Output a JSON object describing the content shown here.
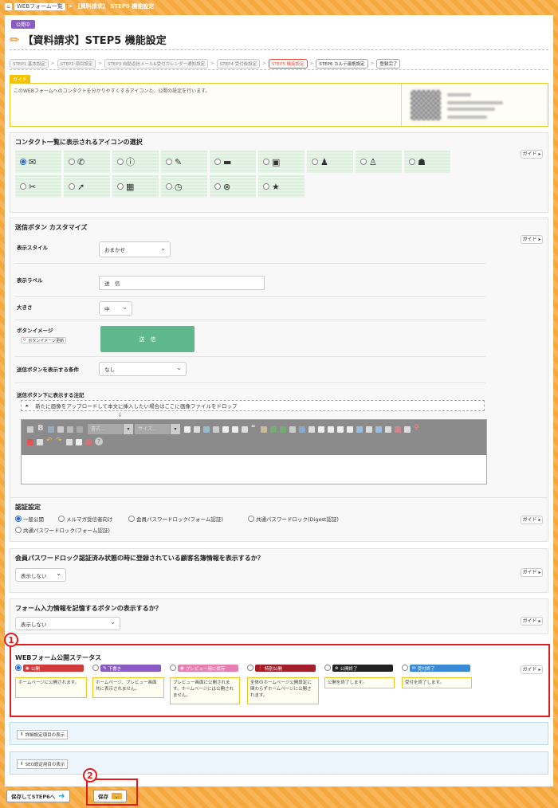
{
  "breadcrumb": {
    "home_icon": "home-icon",
    "item1": "WEBフォーム一覧",
    "item2": "【資料請求】 STEP5 機能設定"
  },
  "header": {
    "badge": "公開中",
    "title": "【資料請求】STEP5 機能設定",
    "title_icon": "pencil-icon"
  },
  "steps": [
    {
      "label": "STEP1 基本設定"
    },
    {
      "label": "STEP2 項目設定"
    },
    {
      "label": "STEP3 自動返信メール&受付カレンダー通知設定"
    },
    {
      "label": "STEP4 受付後設定"
    },
    {
      "label": "STEP5 機能設定"
    },
    {
      "label": "STEP6 カルテ連携設定"
    },
    {
      "label": "登録完了"
    }
  ],
  "guide": {
    "tag": "ガイド",
    "text": "このWEBフォームへのコンタクトを分かりやすくするアイコンと、公開の設定を行います。"
  },
  "guide_button": "ガイド",
  "icon_select": {
    "title": "コンタクト一覧に表示されるアイコンの選択",
    "icons": [
      "mail-icon",
      "phone-icon",
      "exclamation-icon",
      "pen-icon",
      "monitor-icon",
      "note-icon",
      "person-icon",
      "person-alt-icon",
      "people-icon",
      "ticket-icon",
      "arrow-icon",
      "calendar-icon",
      "clock-icon",
      "cancel-icon",
      "star-icon"
    ]
  },
  "send_button": {
    "title": "送信ボタン カスタマイズ",
    "style_label": "表示スタイル",
    "style_value": "おまかせ",
    "text_label": "表示ラベル",
    "text_value": "送　信",
    "size_label": "大きさ",
    "size_value": "中",
    "image_label": "ボタンイメージ",
    "image_update": "ボタンイメージ更新",
    "preview": "送　信",
    "condition_label": "送信ボタンを表示する条件",
    "condition_value": "なし",
    "note_label": "送信ボタン下に表示する注記",
    "drop_text": "新たに画像をアップロードして本文に挿入したい場合はここに画像ファイルをドロップ",
    "format_placeholder": "書式...",
    "size_placeholder": "サイズ..."
  },
  "auth": {
    "title": "認証設定",
    "options": [
      "一般公開",
      "メルマガ受信者向け",
      "会員パスワードロック(フォーム認証)",
      "共通パスワードロック(Digest認証)",
      "共通パスワードロック(フォーム認証)"
    ]
  },
  "member_info": {
    "title": "会員パスワードロック認証済み状態の時に登録されている顧客名簿情報を表示するか？",
    "value": "表示しない"
  },
  "remember": {
    "title": "フォーム入力情報を記憶するボタンの表示するか？",
    "value": "表示しない"
  },
  "status": {
    "title": "WEBフォーム公開ステータス",
    "items": [
      {
        "label": "公開",
        "desc": "ホームページに公開されます。",
        "color": "#d23b3b"
      },
      {
        "label": "下書き",
        "desc": "ホームページ、プレビュー画面共に表示されません。",
        "color": "#8a5bc4"
      },
      {
        "label": "プレビュー用に保存",
        "desc": "プレビュー画面に公開されます。ホームページには公開されません。",
        "color": "#e77fb2"
      },
      {
        "label": "特別公開",
        "desc": "全体のホームページ公開設定に関わらずホームページに公開されます。",
        "color": "#a31f2a"
      },
      {
        "label": "公開終了",
        "desc": "公開を終了します。",
        "color": "#222222"
      },
      {
        "label": "受付終了",
        "desc": "受付を終了します。",
        "color": "#3a8ad6"
      }
    ]
  },
  "advanced": {
    "label": "詳細設定項目の表示"
  },
  "seo": {
    "label": "SEO設定用目の表示"
  },
  "footer": {
    "next_button": "保存してSTEP6へ",
    "save_button": "保存"
  },
  "annotations": {
    "n1": "1",
    "n2": "2"
  }
}
